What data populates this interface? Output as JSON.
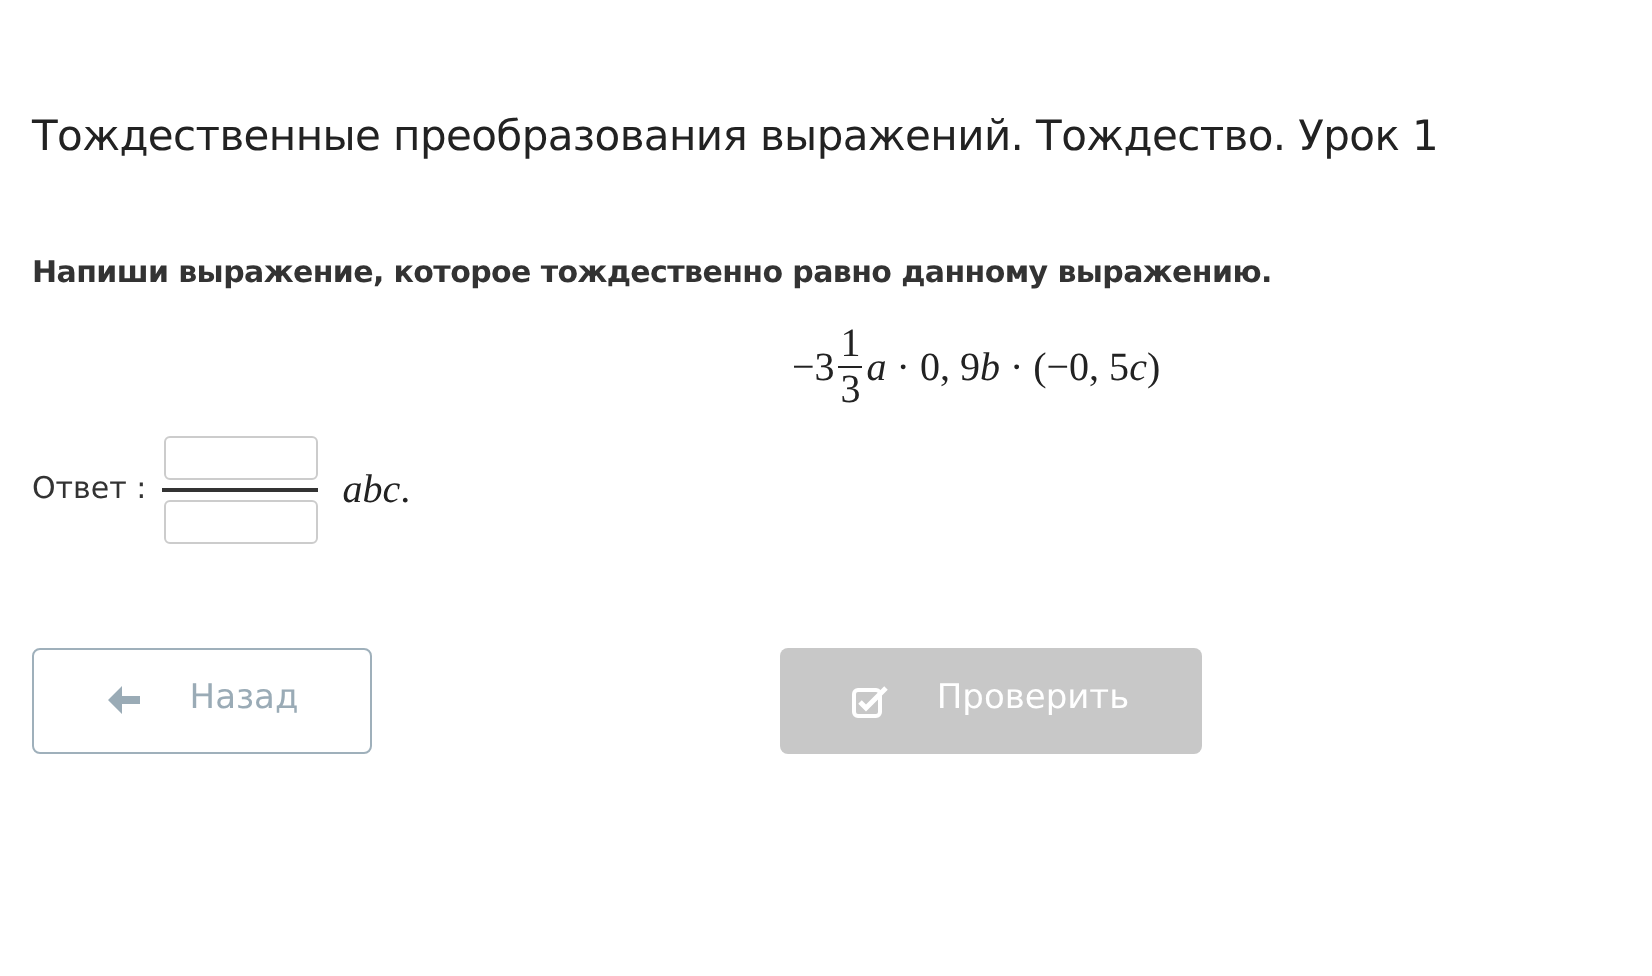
{
  "title": "Тождественные преобразования выражений. Тождество. Урок 1",
  "task": "Напиши выражение, которое тождественно равно данному выражению.",
  "expression": {
    "whole": "−3",
    "numerator": "1",
    "denominator": "3",
    "rest": [
      {
        "text": "a",
        "italic": true
      },
      {
        "text": " · 0, 9",
        "italic": false
      },
      {
        "text": "b",
        "italic": true
      },
      {
        "text": " · (−0, 5",
        "italic": false
      },
      {
        "text": "c",
        "italic": true
      },
      {
        "text": ")",
        "italic": false
      }
    ]
  },
  "answer": {
    "label": "Ответ :",
    "suffix": "*abc*."
  },
  "buttons": [
    {
      "kind": "back",
      "label": "Назад",
      "disabled": false
    },
    {
      "kind": "check",
      "label": "Проверить",
      "disabled": true
    }
  ]
}
